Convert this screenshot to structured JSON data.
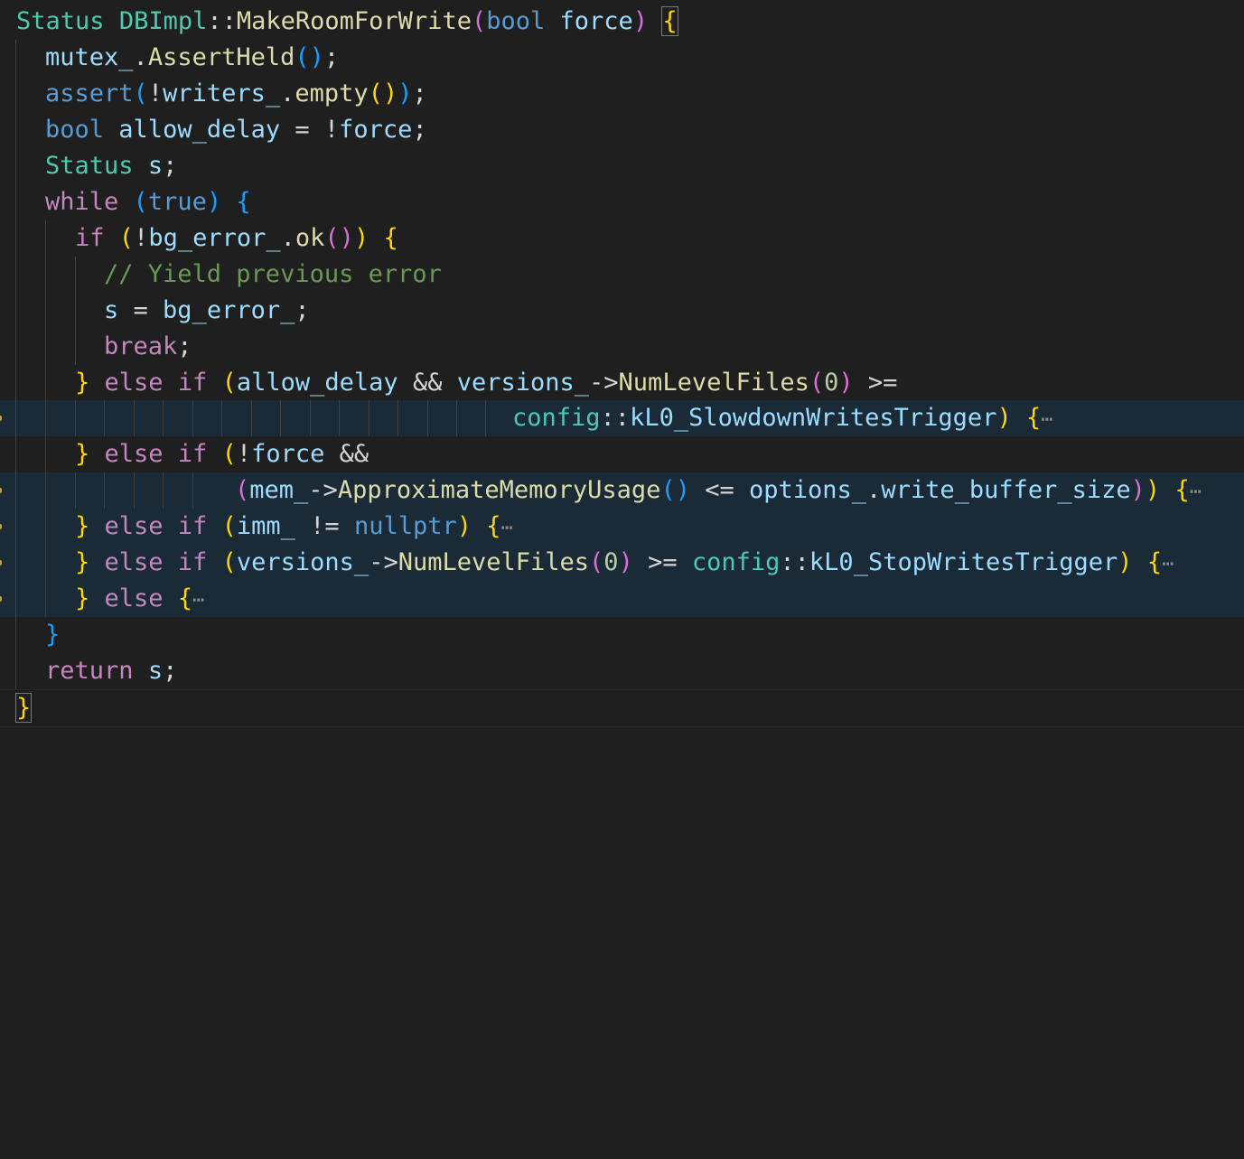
{
  "editor": {
    "theme_colors": {
      "background": "#1f1f1f",
      "folded_background": "#1b2a37",
      "type": "#4ec9b0",
      "function": "#dcdcaa",
      "keyword": "#569cd6",
      "control": "#c586c0",
      "variable": "#9cdcfe",
      "number": "#b5cea8",
      "comment": "#6a9955",
      "bracket_1": "#ffd700",
      "bracket_2": "#da70d6",
      "bracket_3": "#179fff"
    },
    "fold_ellipsis": "⋯",
    "lines": {
      "l1": {
        "t1": "Status",
        "t2": " ",
        "t3": "DBImpl",
        "t4": "::",
        "t5": "MakeRoomForWrite",
        "t6": "(",
        "t7": "bool",
        "t8": " ",
        "t9": "force",
        "t10": ")",
        "t11": " ",
        "t12": "{"
      },
      "l2": {
        "t1": "mutex_",
        "t2": ".",
        "t3": "AssertHeld",
        "t4": "(",
        "t5": ")",
        "t6": ";"
      },
      "l3": {
        "t1": "assert",
        "t2": "(",
        "t3": "!",
        "t4": "writers_",
        "t5": ".",
        "t6": "empty",
        "t7": "(",
        "t8": ")",
        "t9": ")",
        "t10": ";"
      },
      "l4": {
        "t1": "bool",
        "t2": " ",
        "t3": "allow_delay",
        "t4": " = ",
        "t5": "!",
        "t6": "force",
        "t7": ";"
      },
      "l5": {
        "t1": "Status",
        "t2": " ",
        "t3": "s",
        "t4": ";"
      },
      "l6": {
        "t1": "while",
        "t2": " ",
        "t3": "(",
        "t4": "true",
        "t5": ")",
        "t6": " ",
        "t7": "{"
      },
      "l7": {
        "t1": "if",
        "t2": " ",
        "t3": "(",
        "t4": "!",
        "t5": "bg_error_",
        "t6": ".",
        "t7": "ok",
        "t8": "(",
        "t9": ")",
        "t10": ")",
        "t11": " ",
        "t12": "{"
      },
      "l8": {
        "t1": "// Yield previous error"
      },
      "l9": {
        "t1": "s",
        "t2": " = ",
        "t3": "bg_error_",
        "t4": ";"
      },
      "l10": {
        "t1": "break",
        "t2": ";"
      },
      "l11": {
        "t1": "}",
        "t2": " ",
        "t3": "else",
        "t4": " ",
        "t5": "if",
        "t6": " ",
        "t7": "(",
        "t8": "allow_delay",
        "t9": " && ",
        "t10": "versions_",
        "t11": "->",
        "t12": "NumLevelFiles",
        "t13": "(",
        "t14": "0",
        "t15": ")",
        "t16": " >="
      },
      "l12": {
        "t1": "config",
        "t2": "::",
        "t3": "kL0_SlowdownWritesTrigger",
        "t4": ")",
        "t5": " ",
        "t6": "{"
      },
      "l13": {
        "t1": "}",
        "t2": " ",
        "t3": "else",
        "t4": " ",
        "t5": "if",
        "t6": " ",
        "t7": "(",
        "t8": "!",
        "t9": "force",
        "t10": " &&"
      },
      "l14": {
        "t1": "(",
        "t2": "mem_",
        "t3": "->",
        "t4": "ApproximateMemoryUsage",
        "t5": "(",
        "t6": ")",
        "t7": " <= ",
        "t8": "options_",
        "t9": ".",
        "t10": "write_buffer_size",
        "t11": ")",
        "t12": ")",
        "t13": " ",
        "t14": "{"
      },
      "l15": {
        "t1": "}",
        "t2": " ",
        "t3": "else",
        "t4": " ",
        "t5": "if",
        "t6": " ",
        "t7": "(",
        "t8": "imm_",
        "t9": " != ",
        "t10": "nullptr",
        "t11": ")",
        "t12": " ",
        "t13": "{"
      },
      "l16": {
        "t1": "}",
        "t2": " ",
        "t3": "else",
        "t4": " ",
        "t5": "if",
        "t6": " ",
        "t7": "(",
        "t8": "versions_",
        "t9": "->",
        "t10": "NumLevelFiles",
        "t11": "(",
        "t12": "0",
        "t13": ")",
        "t14": " >= ",
        "t15": "config",
        "t16": "::",
        "t17": "kL0_StopWritesTrigger",
        "t18": ")",
        "t19": " ",
        "t20": "{"
      },
      "l17": {
        "t1": "}",
        "t2": " ",
        "t3": "else",
        "t4": " ",
        "t5": "{"
      },
      "l18": {
        "t1": "}"
      },
      "l19": {
        "t1": "return",
        "t2": " ",
        "t3": "s",
        "t4": ";"
      },
      "l20": {
        "t1": "}"
      }
    }
  }
}
